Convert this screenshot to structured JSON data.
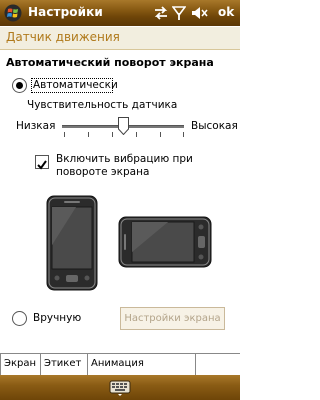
{
  "titlebar": {
    "app_title": "Настройки",
    "ok_label": "ok"
  },
  "page": {
    "title": "Датчик движения"
  },
  "section": {
    "title": "Автоматический поворот экрана"
  },
  "auto_option": {
    "label": "Автоматически",
    "selected": true
  },
  "sensitivity": {
    "label": "Чувствительность датчика",
    "min_label": "Низкая",
    "max_label": "Высокая",
    "value_fraction": 0.5
  },
  "vibration": {
    "label_line1": "Включить вибрацию при",
    "label_line2": "повороте экрана",
    "checked": true
  },
  "manual_option": {
    "label": "Вручную",
    "selected": false
  },
  "screen_settings_button": {
    "label": "Настройки экрана"
  },
  "tabs": [
    {
      "label": "Экран",
      "active": true
    },
    {
      "label": "Этикет",
      "active": false
    },
    {
      "label": "Анимация поворота",
      "active": false
    }
  ],
  "colors": {
    "titlebar": "#8a5c14",
    "header_text": "#b07a1c",
    "header_bg": "#f2eedf"
  }
}
